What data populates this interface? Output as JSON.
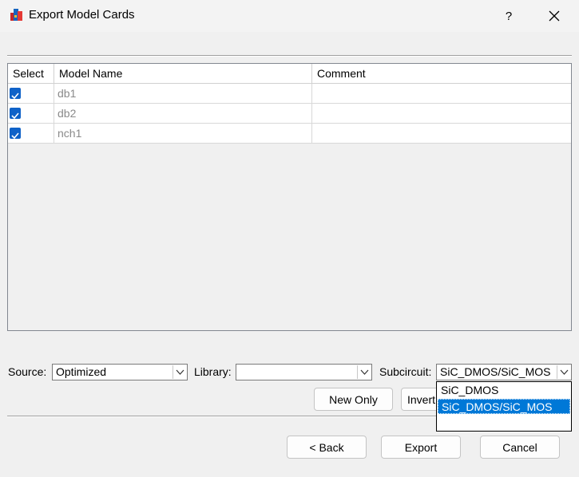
{
  "window": {
    "title": "Export Model Cards",
    "help_label": "?"
  },
  "table": {
    "columns": [
      "Select",
      "Model Name",
      "Comment"
    ],
    "rows": [
      {
        "checked": true,
        "model": "db1",
        "comment": ""
      },
      {
        "checked": true,
        "model": "db2",
        "comment": ""
      },
      {
        "checked": true,
        "model": "nch1",
        "comment": ""
      }
    ]
  },
  "options": {
    "source_label": "Source:",
    "source_value": "Optimized",
    "library_label": "Library:",
    "library_value": "",
    "subcircuit_label": "Subcircuit:",
    "subcircuit_value": "SiC_DMOS/SiC_MOS",
    "subcircuit_options": [
      "SiC_DMOS",
      "SiC_DMOS/SiC_MOS"
    ],
    "subcircuit_selected_index": 1
  },
  "buttons": {
    "new_only": "New Only",
    "invert": "Invert",
    "back": "< Back",
    "export": "Export",
    "cancel": "Cancel"
  },
  "colors": {
    "accent": "#0078d7",
    "checkbox": "#0f62c8"
  }
}
